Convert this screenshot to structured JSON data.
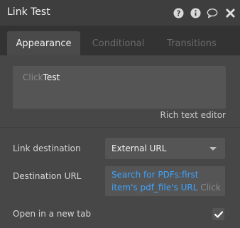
{
  "header": {
    "title": "Link Test",
    "icons": [
      "help-icon",
      "info-icon",
      "comment-icon",
      "close-icon"
    ]
  },
  "tabs": [
    {
      "label": "Appearance",
      "active": true
    },
    {
      "label": "Conditional",
      "active": false
    },
    {
      "label": "Transitions",
      "active": false
    }
  ],
  "editor": {
    "placeholder_part": "Click",
    "text_part": "Test",
    "rich_text_link": "Rich text editor"
  },
  "fields": {
    "link_destination": {
      "label": "Link destination",
      "value": "External URL"
    },
    "destination_url": {
      "label": "Destination URL",
      "dynamic_line1": "Search for PDFs:first",
      "dynamic_line2": "item's pdf_file's URL",
      "trailing": "Click"
    },
    "open_new_tab": {
      "label": "Open in a new tab",
      "checked": true
    }
  },
  "colors": {
    "background": "#3e3e3e",
    "content": "#474747",
    "field": "#555555",
    "dynamic_link": "#3ea4ff"
  }
}
